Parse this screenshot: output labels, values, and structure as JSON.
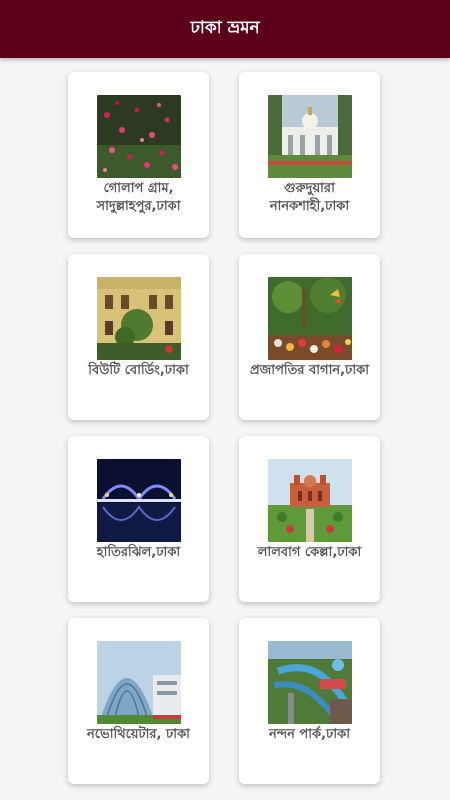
{
  "app": {
    "title": "ঢাকা ভ্রমন"
  },
  "places": [
    {
      "name": "গোলাপ গ্রাম, সাদুল্লাহপুর,ঢাকা"
    },
    {
      "name": "গুরুদুয়ারা নানকশাহী,ঢাকা"
    },
    {
      "name": "বিউটি বোর্ডিং,ঢাকা"
    },
    {
      "name": "প্রজাপতির বাগান,ঢাকা"
    },
    {
      "name": "হাতিরঝিল,ঢাকা"
    },
    {
      "name": "লালবাগ কেল্লা,ঢাকা"
    },
    {
      "name": "নভোথিয়েটার, ঢাকা"
    },
    {
      "name": "নন্দন পার্ক,ঢাকা"
    }
  ],
  "colors": {
    "appbar": "#5b0018",
    "background": "#f5f5f5",
    "card": "#ffffff",
    "caption": "#555555"
  }
}
